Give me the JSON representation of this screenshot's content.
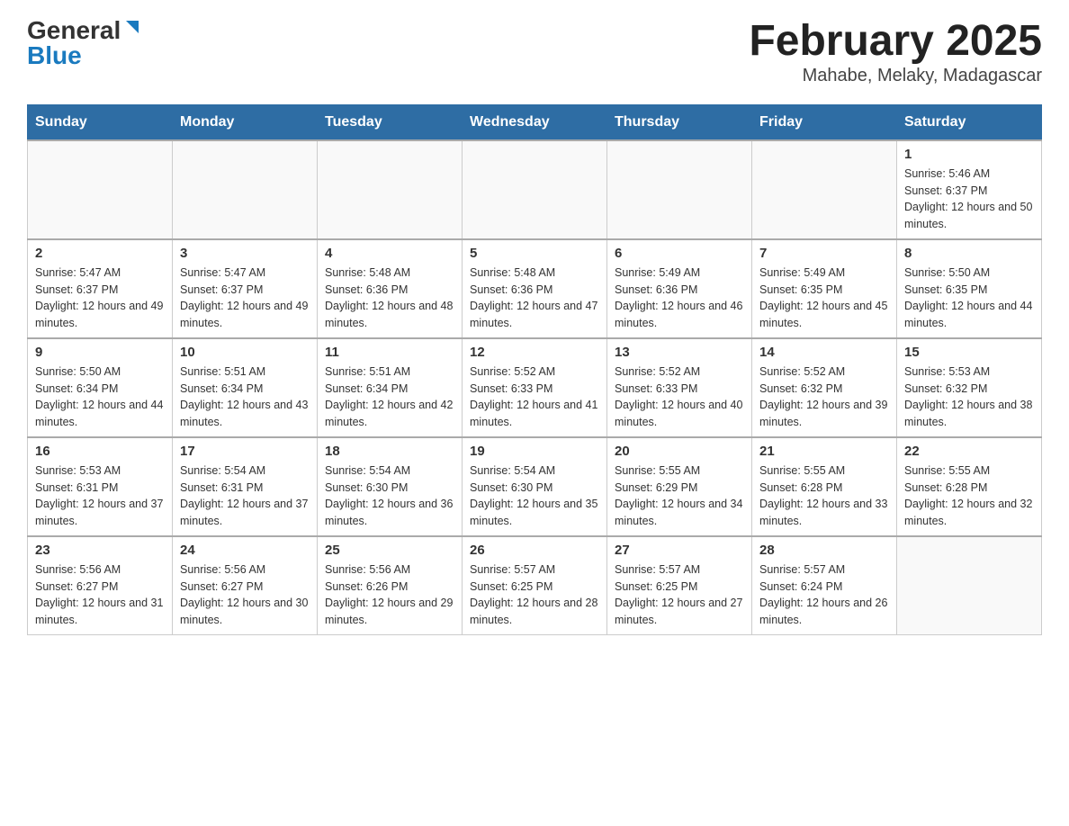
{
  "logo": {
    "general": "General",
    "blue": "Blue"
  },
  "title": "February 2025",
  "subtitle": "Mahabe, Melaky, Madagascar",
  "days_of_week": [
    "Sunday",
    "Monday",
    "Tuesday",
    "Wednesday",
    "Thursday",
    "Friday",
    "Saturday"
  ],
  "weeks": [
    [
      {
        "day": "",
        "info": ""
      },
      {
        "day": "",
        "info": ""
      },
      {
        "day": "",
        "info": ""
      },
      {
        "day": "",
        "info": ""
      },
      {
        "day": "",
        "info": ""
      },
      {
        "day": "",
        "info": ""
      },
      {
        "day": "1",
        "info": "Sunrise: 5:46 AM\nSunset: 6:37 PM\nDaylight: 12 hours and 50 minutes."
      }
    ],
    [
      {
        "day": "2",
        "info": "Sunrise: 5:47 AM\nSunset: 6:37 PM\nDaylight: 12 hours and 49 minutes."
      },
      {
        "day": "3",
        "info": "Sunrise: 5:47 AM\nSunset: 6:37 PM\nDaylight: 12 hours and 49 minutes."
      },
      {
        "day": "4",
        "info": "Sunrise: 5:48 AM\nSunset: 6:36 PM\nDaylight: 12 hours and 48 minutes."
      },
      {
        "day": "5",
        "info": "Sunrise: 5:48 AM\nSunset: 6:36 PM\nDaylight: 12 hours and 47 minutes."
      },
      {
        "day": "6",
        "info": "Sunrise: 5:49 AM\nSunset: 6:36 PM\nDaylight: 12 hours and 46 minutes."
      },
      {
        "day": "7",
        "info": "Sunrise: 5:49 AM\nSunset: 6:35 PM\nDaylight: 12 hours and 45 minutes."
      },
      {
        "day": "8",
        "info": "Sunrise: 5:50 AM\nSunset: 6:35 PM\nDaylight: 12 hours and 44 minutes."
      }
    ],
    [
      {
        "day": "9",
        "info": "Sunrise: 5:50 AM\nSunset: 6:34 PM\nDaylight: 12 hours and 44 minutes."
      },
      {
        "day": "10",
        "info": "Sunrise: 5:51 AM\nSunset: 6:34 PM\nDaylight: 12 hours and 43 minutes."
      },
      {
        "day": "11",
        "info": "Sunrise: 5:51 AM\nSunset: 6:34 PM\nDaylight: 12 hours and 42 minutes."
      },
      {
        "day": "12",
        "info": "Sunrise: 5:52 AM\nSunset: 6:33 PM\nDaylight: 12 hours and 41 minutes."
      },
      {
        "day": "13",
        "info": "Sunrise: 5:52 AM\nSunset: 6:33 PM\nDaylight: 12 hours and 40 minutes."
      },
      {
        "day": "14",
        "info": "Sunrise: 5:52 AM\nSunset: 6:32 PM\nDaylight: 12 hours and 39 minutes."
      },
      {
        "day": "15",
        "info": "Sunrise: 5:53 AM\nSunset: 6:32 PM\nDaylight: 12 hours and 38 minutes."
      }
    ],
    [
      {
        "day": "16",
        "info": "Sunrise: 5:53 AM\nSunset: 6:31 PM\nDaylight: 12 hours and 37 minutes."
      },
      {
        "day": "17",
        "info": "Sunrise: 5:54 AM\nSunset: 6:31 PM\nDaylight: 12 hours and 37 minutes."
      },
      {
        "day": "18",
        "info": "Sunrise: 5:54 AM\nSunset: 6:30 PM\nDaylight: 12 hours and 36 minutes."
      },
      {
        "day": "19",
        "info": "Sunrise: 5:54 AM\nSunset: 6:30 PM\nDaylight: 12 hours and 35 minutes."
      },
      {
        "day": "20",
        "info": "Sunrise: 5:55 AM\nSunset: 6:29 PM\nDaylight: 12 hours and 34 minutes."
      },
      {
        "day": "21",
        "info": "Sunrise: 5:55 AM\nSunset: 6:28 PM\nDaylight: 12 hours and 33 minutes."
      },
      {
        "day": "22",
        "info": "Sunrise: 5:55 AM\nSunset: 6:28 PM\nDaylight: 12 hours and 32 minutes."
      }
    ],
    [
      {
        "day": "23",
        "info": "Sunrise: 5:56 AM\nSunset: 6:27 PM\nDaylight: 12 hours and 31 minutes."
      },
      {
        "day": "24",
        "info": "Sunrise: 5:56 AM\nSunset: 6:27 PM\nDaylight: 12 hours and 30 minutes."
      },
      {
        "day": "25",
        "info": "Sunrise: 5:56 AM\nSunset: 6:26 PM\nDaylight: 12 hours and 29 minutes."
      },
      {
        "day": "26",
        "info": "Sunrise: 5:57 AM\nSunset: 6:25 PM\nDaylight: 12 hours and 28 minutes."
      },
      {
        "day": "27",
        "info": "Sunrise: 5:57 AM\nSunset: 6:25 PM\nDaylight: 12 hours and 27 minutes."
      },
      {
        "day": "28",
        "info": "Sunrise: 5:57 AM\nSunset: 6:24 PM\nDaylight: 12 hours and 26 minutes."
      },
      {
        "day": "",
        "info": ""
      }
    ]
  ]
}
